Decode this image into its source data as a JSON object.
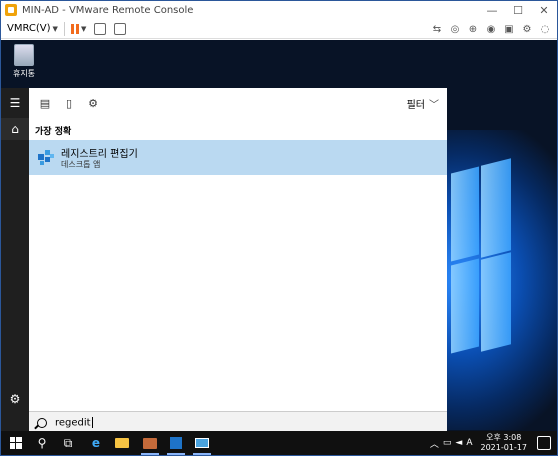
{
  "window": {
    "title": "MIN-AD - VMware Remote Console"
  },
  "toolbar": {
    "menu_label": "VMRC(V)",
    "accent": "#f26b1d"
  },
  "desktop": {
    "recycle_label": "휴지통"
  },
  "search": {
    "filter_label": "필터",
    "section_label": "가장 정확",
    "result_title": "레지스트리 편집기",
    "result_subtitle": "데스크톱 앱",
    "query": "regedit",
    "highlight": "#bad9f1"
  },
  "taskbar": {
    "time": "오후 3:08",
    "date": "2021-01-17",
    "ime": "A"
  }
}
